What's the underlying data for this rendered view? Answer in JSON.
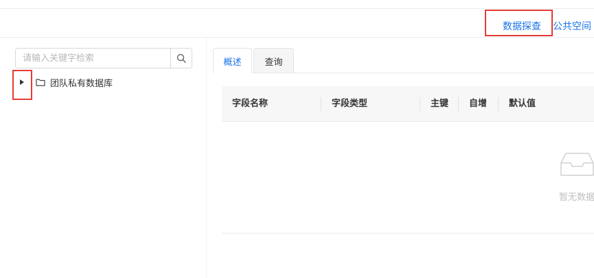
{
  "nav": {
    "data_explore": "数据探查",
    "public_space": "公共空间"
  },
  "search": {
    "placeholder": "请输入关键字检索",
    "value": ""
  },
  "tree": {
    "root_label": "团队私有数据库"
  },
  "tabs": [
    {
      "label": "概述"
    },
    {
      "label": "查询"
    }
  ],
  "table": {
    "columns": [
      "字段名称",
      "字段类型",
      "主键",
      "自增",
      "默认值"
    ],
    "empty_text": "暂无数据"
  },
  "colors": {
    "accent": "#1a73e8",
    "highlight": "#e53935"
  }
}
